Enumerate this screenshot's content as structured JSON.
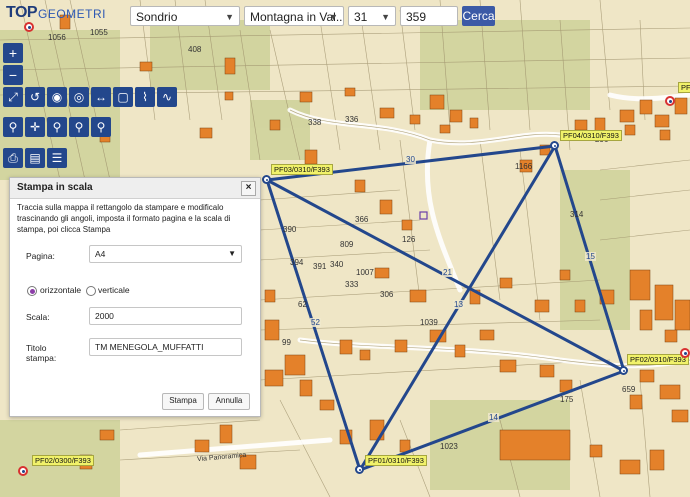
{
  "search": {
    "province": "Sondrio",
    "municipality": "Montagna in Val...",
    "sheet": "31",
    "parcel": "359",
    "button": "Cerca",
    "dropdown_icon": "chevron-down-icon"
  },
  "logo": {
    "top": "TOP",
    "geometri": "GEOMETRI"
  },
  "toolbar": {
    "zoom_in": "+",
    "zoom_out": "−",
    "icons": [
      "expand-icon",
      "rotate-icon",
      "target-icon",
      "circle-target-icon",
      "measure-distance-icon",
      "square-icon",
      "polygon-icon",
      "curve-icon",
      "marker-icon",
      "crosshair-icon",
      "add-marker-icon",
      "markers-icon",
      "search-zoom-icon",
      "print-icon",
      "map-book-icon",
      "list-icon"
    ]
  },
  "dialog": {
    "title": "Stampa in scala",
    "close": "×",
    "instructions": "Traccia sulla mappa il rettangolo da stampare e modificalo trascinando gli angoli, imposta il formato pagina e la scala di stampa, poi clicca Stampa",
    "page_label": "Pagina:",
    "page_value": "A4",
    "orientation_horizontal": "orizzontale",
    "orientation_vertical": "verticale",
    "scale_label": "Scala:",
    "scale_value": "2000",
    "title_label_1": "Titolo",
    "title_label_2": "stampa:",
    "title_value": "TM MENEGOLA_MUFFATTI",
    "print_button": "Stampa",
    "cancel_button": "Annulla"
  },
  "points": {
    "pf03": "PF03/0310/F393",
    "pf04": "PF04/0310/F393",
    "pf02": "PF02/0310/F393",
    "pf01": "PF01/0310/F393",
    "pf02b": "PF02/0300/F393",
    "pf0_partial": "PF0"
  },
  "edges": {
    "e30": "30",
    "e15": "15",
    "e14": "14",
    "e52": "52",
    "e21": "21",
    "e13": "13"
  },
  "map_labels": {
    "l1": "1056",
    "l2": "1055",
    "l3": "408",
    "l4": "338",
    "l5": "336",
    "l6": "390",
    "l7": "366",
    "l8": "1166",
    "l9": "126",
    "l10": "809",
    "l11": "391",
    "l12": "394",
    "l13": "1007",
    "l14": "659",
    "l15": "314",
    "l16": "296",
    "l17": "62",
    "l18": "99",
    "l19": "175",
    "l20": "1039",
    "l21": "340",
    "l22": "333",
    "l23": "1023",
    "l24": "306"
  },
  "road_label": "Via Panoramica",
  "colors": {
    "accent": "#23478c",
    "building": "#e4812a",
    "label_bg": "#f1f26a",
    "map_bg": "#efe6c6"
  }
}
